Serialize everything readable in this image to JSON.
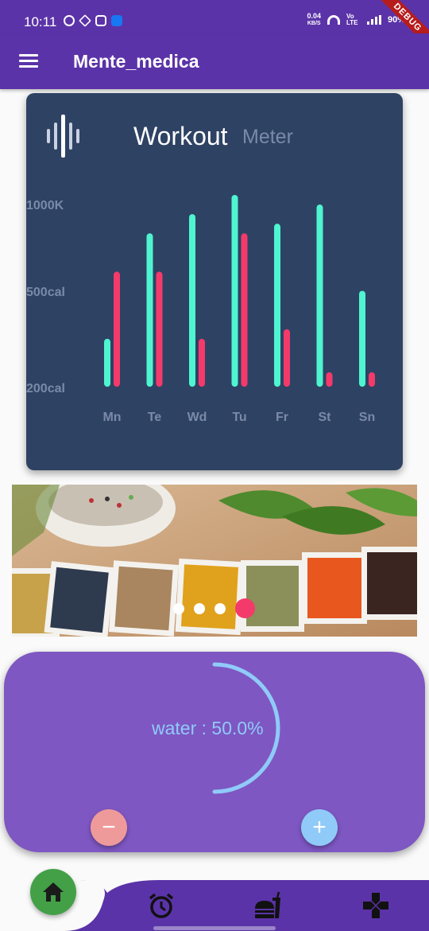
{
  "status_bar": {
    "time": "10:11",
    "net_speed": "0.04",
    "net_unit": "KB/S",
    "volte": "Vo LTE",
    "battery": "90%",
    "debug_label": "DEBUG"
  },
  "app_bar": {
    "title": "Mente_medica",
    "menu_icon": "hamburger-menu-icon"
  },
  "workout_chart": {
    "title_main": "Workout",
    "title_sub": "Meter",
    "colors": {
      "card": "#2e4264",
      "primary": "#4ef5d0",
      "secondary": "#f43a6a",
      "axis_text": "#7a8aa8"
    }
  },
  "chart_data": {
    "type": "bar",
    "title": "Workout Meter",
    "categories": [
      "Mn",
      "Te",
      "Wd",
      "Tu",
      "Fr",
      "St",
      "Sn"
    ],
    "y_tick_labels": [
      "1000K",
      "500cal",
      "200cal"
    ],
    "series": [
      {
        "values": [
          5,
          16,
          18,
          20,
          17,
          19,
          10
        ]
      },
      {
        "values": [
          12,
          12,
          5,
          16,
          6,
          1.5,
          1.5
        ]
      }
    ],
    "ylim": [
      0,
      20
    ],
    "grid": false
  },
  "carousel": {
    "slide_count": 4,
    "active_index": 3
  },
  "water_tracker": {
    "label": "water : 50.0%",
    "progress": 0.5,
    "minus_label": "−",
    "plus_label": "+"
  },
  "bottom_nav": {
    "items": [
      "home-icon",
      "alarm-clock-icon",
      "fast-food-icon",
      "gamepad-icon"
    ],
    "active": "home-icon"
  }
}
